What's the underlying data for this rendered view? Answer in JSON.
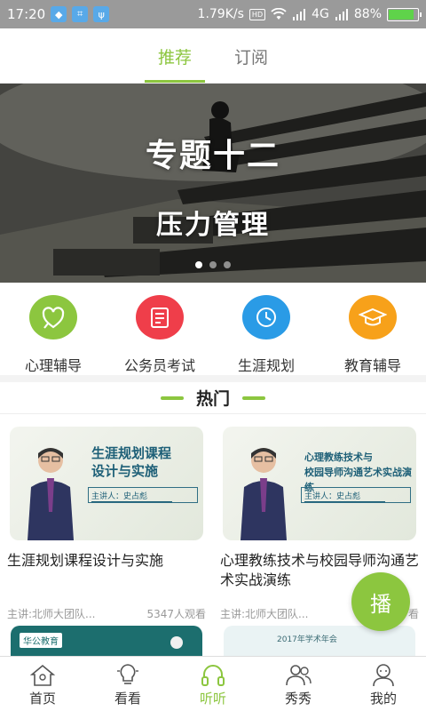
{
  "status_bar": {
    "time": "17:20",
    "network_speed": "1.79K/s",
    "hd": "HD",
    "signal": "4G",
    "battery": "88%",
    "battery_level": 0.88
  },
  "top_tabs": [
    {
      "label": "推荐",
      "active": true
    },
    {
      "label": "订阅",
      "active": false
    }
  ],
  "banner": {
    "title": "专题十二",
    "subtitle": "压力管理",
    "page_count": 3,
    "current_page": 1
  },
  "categories": [
    {
      "label": "心理辅导",
      "color": "#8cc63f",
      "icon": "heart-chat-icon"
    },
    {
      "label": "公务员考试",
      "color": "#ef3e4a",
      "icon": "exam-paper-icon"
    },
    {
      "label": "生涯规划",
      "color": "#2a9be6",
      "icon": "clock-icon"
    },
    {
      "label": "教育辅导",
      "color": "#f7a11a",
      "icon": "graduation-cap-icon"
    }
  ],
  "hot": {
    "title": "热门"
  },
  "courses": [
    {
      "thumb_title": "生涯规划课程\n设计与实施",
      "thumb_lecturer": "主讲人：史占彪",
      "title": "生涯规划课程设计与实施",
      "author": "主讲:北师大团队...",
      "views": "5347人观看"
    },
    {
      "thumb_title": "心理教练技术与\n校园导师沟通艺术实战演练",
      "thumb_lecturer": "主讲人：史占彪",
      "title": "心理教练技术与校园导师沟通艺术实战演练",
      "author": "主讲:北师大团队...",
      "views": "看"
    }
  ],
  "next_cards": [
    {
      "brand": "华公教育"
    },
    {
      "header": "2017年学术年会"
    }
  ],
  "fab": {
    "label": "播"
  },
  "bottom_nav": [
    {
      "label": "首页",
      "icon": "home-icon",
      "active": false
    },
    {
      "label": "看看",
      "icon": "lightbulb-icon",
      "active": false
    },
    {
      "label": "听听",
      "icon": "headphones-icon",
      "active": true
    },
    {
      "label": "秀秀",
      "icon": "people-icon",
      "active": false
    },
    {
      "label": "我的",
      "icon": "profile-icon",
      "active": false
    }
  ],
  "colors": {
    "accent": "#8cc63f",
    "status_bar": "#9a9a9a",
    "thumb_text": "#1d5f77"
  }
}
